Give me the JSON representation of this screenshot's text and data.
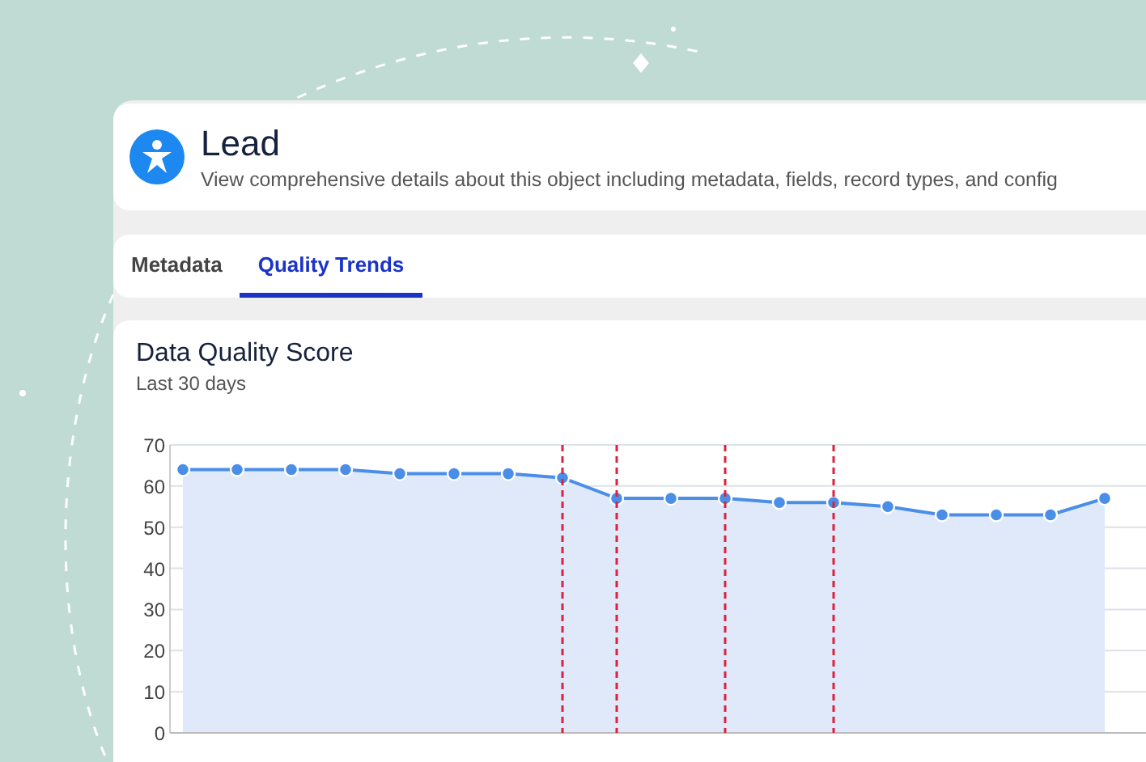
{
  "header": {
    "title": "Lead",
    "description": "View comprehensive details about this object including metadata, fields, record types, and config"
  },
  "tabs": [
    {
      "label": "Metadata",
      "selected": false
    },
    {
      "label": "Quality Trends",
      "selected": true
    }
  ],
  "chart_card": {
    "subtitle": "Last 30 days",
    "chart_data": {
      "type": "line",
      "title": "Data Quality Score",
      "ylim": [
        0,
        70
      ],
      "yticks": [
        0,
        10,
        20,
        30,
        40,
        50,
        60,
        70
      ],
      "grid": true,
      "series": [
        {
          "color": "#4a8ee8",
          "marker": "circle",
          "values": [
            64,
            64,
            64,
            64,
            63,
            63,
            63,
            62,
            57,
            57,
            57,
            56,
            56,
            55,
            53,
            53,
            53,
            57
          ]
        }
      ]
    }
  }
}
